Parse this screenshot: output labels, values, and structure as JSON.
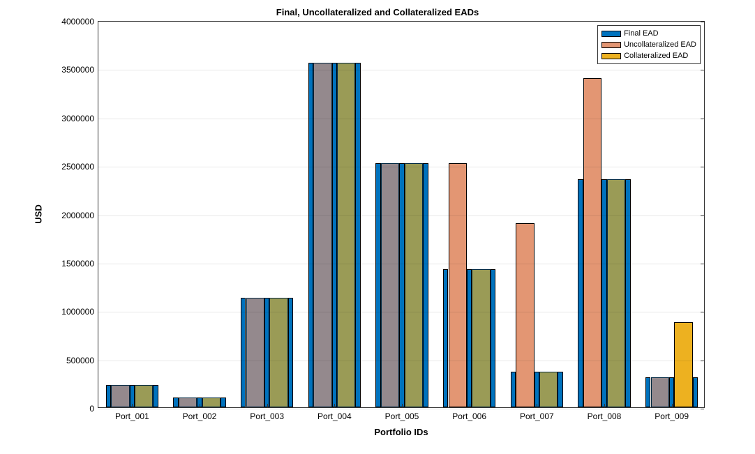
{
  "chart_data": {
    "type": "bar",
    "title": "Final, Uncollateralized and Collateralized EADs",
    "xlabel": "Portfolio IDs",
    "ylabel": "USD",
    "ylim": [
      0,
      4000000
    ],
    "yticks": [
      0,
      500000,
      1000000,
      1500000,
      2000000,
      2500000,
      3000000,
      3500000,
      4000000
    ],
    "categories": [
      "Port_001",
      "Port_002",
      "Port_003",
      "Port_004",
      "Port_005",
      "Port_006",
      "Port_007",
      "Port_008",
      "Port_009"
    ],
    "series": [
      {
        "name": "Final EAD",
        "color": "#0072bd",
        "values": [
          230000,
          100000,
          1130000,
          3560000,
          2520000,
          1430000,
          370000,
          2360000,
          310000
        ]
      },
      {
        "name": "Uncollateralized EAD",
        "color": "#e39673",
        "values": [
          230000,
          100000,
          1130000,
          3560000,
          2520000,
          2520000,
          1900000,
          3400000,
          310000
        ]
      },
      {
        "name": "Collateralized EAD",
        "color": "#edb120",
        "values": [
          230000,
          100000,
          1130000,
          3560000,
          2520000,
          1430000,
          370000,
          2360000,
          880000
        ]
      }
    ],
    "legend_position": "northeast"
  }
}
